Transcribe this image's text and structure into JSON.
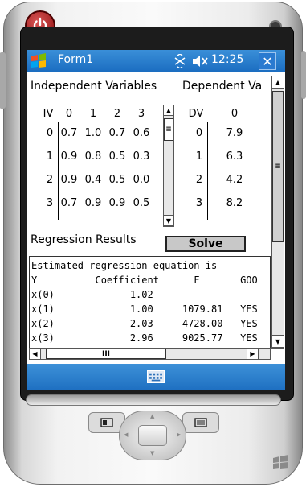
{
  "titlebar": {
    "app_title": "Form1",
    "clock": "12:25"
  },
  "labels": {
    "independent": "Independent Variables",
    "dependent": "Dependent Va",
    "regression": "Regression Results"
  },
  "iv_grid": {
    "corner": "IV",
    "columns": [
      "0",
      "1",
      "2",
      "3"
    ],
    "rows": [
      {
        "index": "0",
        "cells": [
          "0.7",
          "1.0",
          "0.7",
          "0.6"
        ]
      },
      {
        "index": "1",
        "cells": [
          "0.9",
          "0.8",
          "0.5",
          "0.3"
        ]
      },
      {
        "index": "2",
        "cells": [
          "0.9",
          "0.4",
          "0.5",
          "0.0"
        ]
      },
      {
        "index": "3",
        "cells": [
          "0.7",
          "0.9",
          "0.9",
          "0.5"
        ]
      }
    ]
  },
  "dv_grid": {
    "corner": "DV",
    "column": "0",
    "rows": [
      {
        "index": "0",
        "value": "7.9"
      },
      {
        "index": "1",
        "value": "6.3"
      },
      {
        "index": "2",
        "value": "4.2"
      },
      {
        "index": "3",
        "value": "8.2"
      }
    ]
  },
  "solve_label": "Solve",
  "results": {
    "lines": [
      "Estimated regression equation is",
      "Y          Coefficient      F       GOO",
      "x(0)             1.02",
      "x(1)             1.00     1079.81   YES",
      "x(2)             2.03     4728.00   YES",
      "x(3)             2.96     9025.77   YES"
    ]
  },
  "icons": {
    "power": "power-icon",
    "start": "windows-flag-icon",
    "connectivity": "connectivity-icon",
    "volume": "speaker-muted-icon",
    "close": "close-icon",
    "keyboard": "keyboard-icon"
  },
  "colors": {
    "title_bar": "#1a6cc0",
    "menu_bar": "#1e6fc1",
    "power_button": "#8c0e0e"
  }
}
